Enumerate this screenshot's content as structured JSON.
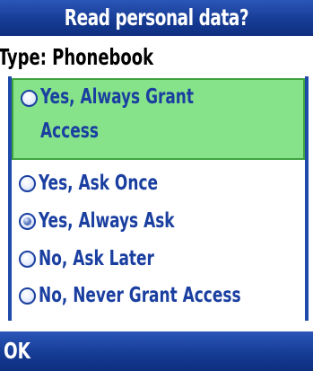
{
  "dialog": {
    "title": "Read personal data?",
    "subtitle": "Type: Phonebook"
  },
  "options": [
    {
      "label": "Yes, Always Grant Access",
      "selected": true,
      "checked": false
    },
    {
      "label": "Yes, Ask Once",
      "selected": false,
      "checked": false
    },
    {
      "label": "Yes, Always Ask",
      "selected": false,
      "checked": true
    },
    {
      "label": "No, Ask Later",
      "selected": false,
      "checked": false
    },
    {
      "label": "No, Never Grant Access",
      "selected": false,
      "checked": false
    }
  ],
  "softkeys": {
    "left": "OK"
  }
}
